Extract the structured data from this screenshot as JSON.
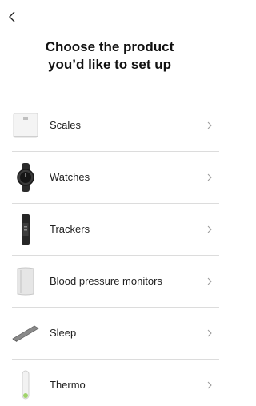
{
  "header": {
    "back_icon": "chevron-left-icon",
    "title_line1": "Choose the product",
    "title_line2": "you’d like to set up"
  },
  "products": [
    {
      "label": "Scales",
      "icon": "scale-icon"
    },
    {
      "label": "Watches",
      "icon": "watch-icon"
    },
    {
      "label": "Trackers",
      "icon": "tracker-icon"
    },
    {
      "label": "Blood pressure monitors",
      "icon": "blood-pressure-monitor-icon"
    },
    {
      "label": "Sleep",
      "icon": "sleep-mat-icon"
    },
    {
      "label": "Thermo",
      "icon": "thermometer-icon"
    }
  ],
  "colors": {
    "text": "#1a1a1a",
    "divider": "#dcdcdc",
    "chevron": "#9a9a9a"
  }
}
